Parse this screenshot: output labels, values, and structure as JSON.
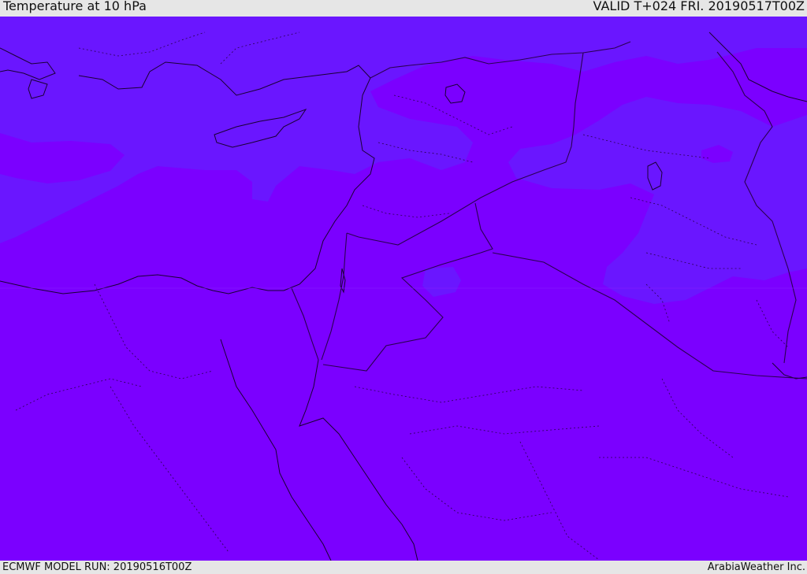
{
  "header": {
    "title": "Temperature at 10 hPa",
    "valid": "VALID T+024 FRI. 20190517T00Z"
  },
  "footer": {
    "model_run": "ECMWF MODEL RUN: 20190516T00Z",
    "credit": "ArabiaWeather Inc."
  },
  "colors": {
    "base_fill": "#7b00ff",
    "warm_band_fill": "#6a16ff",
    "coastline": "#1a0033",
    "border": "#2a0050"
  }
}
